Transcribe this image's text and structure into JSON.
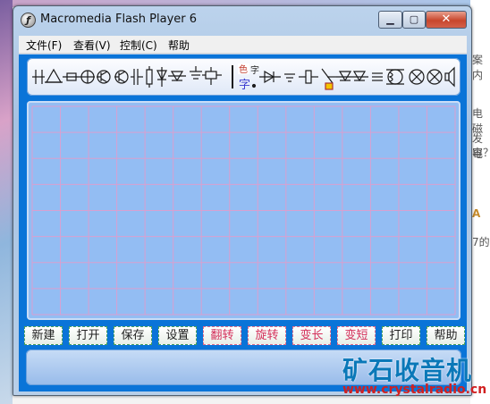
{
  "window": {
    "title": "Macromedia Flash Player 6",
    "icon": "flash-player-icon",
    "controls": {
      "minimize": "minimize-icon",
      "maximize": "maximize-icon",
      "close": "close-icon"
    }
  },
  "menubar": {
    "items": [
      {
        "label": "文件(F)"
      },
      {
        "label": "查看(V)"
      },
      {
        "label": "控制(C)"
      },
      {
        "label": "帮助"
      }
    ]
  },
  "toolbar": {
    "icons": [
      "wire-junction-icon",
      "triangle-icon",
      "wire-icon",
      "diode-icon",
      "transistor-icon",
      "transistor-icon",
      "capacitor-icon",
      "resistor-icon",
      "diode-icon",
      "ground-icon",
      "switch-icon",
      "component-icon",
      "color-icon",
      "text-icon",
      "diode-icon",
      "ground-icon",
      "resistor-icon",
      "diode-icon",
      "transformer-icon",
      "lamp-icon",
      "speaker-icon"
    ],
    "color_label": "色",
    "font_label": "字",
    "text_label": "字"
  },
  "canvas": {
    "grid_columns": 15,
    "grid_rows": 8,
    "grid_color": "#d8a0d0",
    "background": "#93bdf3"
  },
  "buttons": [
    {
      "label": "新建",
      "tone": "normal"
    },
    {
      "label": "打开",
      "tone": "normal"
    },
    {
      "label": "保存",
      "tone": "normal"
    },
    {
      "label": "设置",
      "tone": "normal"
    },
    {
      "label": "翻转",
      "tone": "warm"
    },
    {
      "label": "旋转",
      "tone": "warm"
    },
    {
      "label": "变长",
      "tone": "warm"
    },
    {
      "label": "变短",
      "tone": "warm"
    },
    {
      "label": "打印",
      "tone": "normal"
    },
    {
      "label": "帮助",
      "tone": "normal"
    }
  ],
  "watermark": {
    "title": "矿石收音机",
    "url": "www.crystalradio.cn"
  },
  "background_snippets": [
    "案内",
    "电磁",
    "发电",
    "容？",
    "A",
    "7的"
  ],
  "colors": {
    "stage": "#0a74d8",
    "accent": "#0a78b8",
    "url": "#d12020"
  }
}
